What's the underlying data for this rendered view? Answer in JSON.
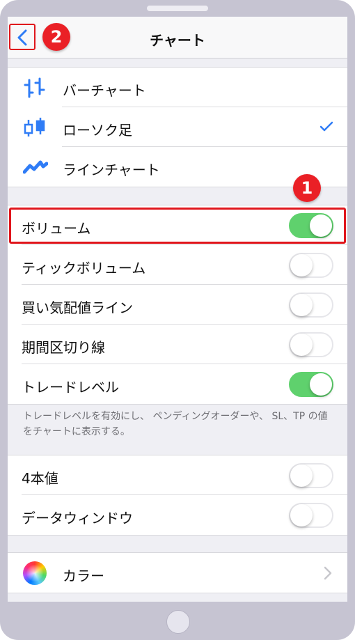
{
  "header": {
    "title": "チャート"
  },
  "badges": {
    "one": "1",
    "two": "2"
  },
  "chart_types": [
    {
      "label": "バーチャート",
      "icon": "bar-chart-icon",
      "selected": false
    },
    {
      "label": "ローソク足",
      "icon": "candlestick-icon",
      "selected": true
    },
    {
      "label": "ラインチャート",
      "icon": "line-chart-icon",
      "selected": false
    }
  ],
  "toggles": [
    {
      "label": "ボリューム",
      "on": true
    },
    {
      "label": "ティックボリューム",
      "on": false
    },
    {
      "label": "買い気配値ライン",
      "on": false
    },
    {
      "label": "期間区切り線",
      "on": false
    },
    {
      "label": "トレードレベル",
      "on": true
    }
  ],
  "footnote": "トレードレベルを有効にし、 ペンディングオーダーや、 SL、TP の値をチャートに表示する。",
  "extra_toggles": [
    {
      "label": "4本値",
      "on": false
    },
    {
      "label": "データウィンドウ",
      "on": false
    }
  ],
  "color_item": {
    "label": "カラー"
  },
  "colors": {
    "accent": "#2f7cf6",
    "toggle_on": "#5fd16d",
    "annotation": "#e0161c"
  }
}
